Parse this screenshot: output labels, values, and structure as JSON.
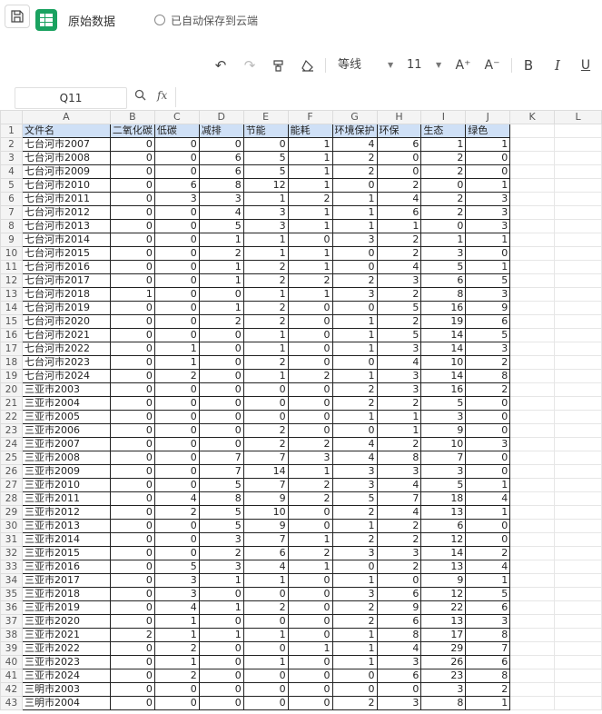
{
  "header": {
    "title": "原始数据",
    "autosave": "已自动保存到云端"
  },
  "toolbar": {
    "font_name": "等线",
    "font_size": "11",
    "increase_font": "A⁺",
    "decrease_font": "A⁻",
    "bold": "B",
    "italic": "I",
    "underline": "U"
  },
  "formula_bar": {
    "cell_ref": "Q11",
    "fx": "fx",
    "content": ""
  },
  "columns": [
    "A",
    "B",
    "C",
    "D",
    "E",
    "F",
    "G",
    "H",
    "I",
    "J",
    "K",
    "L"
  ],
  "header_row": [
    "文件名",
    "二氧化碳",
    "低碳",
    "减排",
    "节能",
    "能耗",
    "环境保护",
    "环保",
    "生态",
    "绿色"
  ],
  "rows": [
    [
      "七台河市2007",
      0,
      0,
      0,
      0,
      1,
      4,
      6,
      1,
      1
    ],
    [
      "七台河市2008",
      0,
      0,
      6,
      5,
      1,
      2,
      0,
      2,
      0
    ],
    [
      "七台河市2009",
      0,
      0,
      6,
      5,
      1,
      2,
      0,
      2,
      0
    ],
    [
      "七台河市2010",
      0,
      6,
      8,
      12,
      1,
      0,
      2,
      0,
      1
    ],
    [
      "七台河市2011",
      0,
      3,
      3,
      1,
      2,
      1,
      4,
      2,
      3
    ],
    [
      "七台河市2012",
      0,
      0,
      4,
      3,
      1,
      1,
      6,
      2,
      3
    ],
    [
      "七台河市2013",
      0,
      0,
      5,
      3,
      1,
      1,
      1,
      0,
      3
    ],
    [
      "七台河市2014",
      0,
      0,
      1,
      1,
      0,
      3,
      2,
      1,
      1
    ],
    [
      "七台河市2015",
      0,
      0,
      2,
      1,
      1,
      0,
      2,
      3,
      0
    ],
    [
      "七台河市2016",
      0,
      0,
      1,
      2,
      1,
      0,
      4,
      5,
      1
    ],
    [
      "七台河市2017",
      0,
      0,
      1,
      2,
      2,
      2,
      3,
      6,
      5
    ],
    [
      "七台河市2018",
      1,
      0,
      0,
      1,
      1,
      3,
      2,
      8,
      3
    ],
    [
      "七台河市2019",
      0,
      0,
      1,
      2,
      0,
      0,
      5,
      16,
      9
    ],
    [
      "七台河市2020",
      0,
      0,
      2,
      2,
      0,
      1,
      2,
      19,
      6
    ],
    [
      "七台河市2021",
      0,
      0,
      0,
      1,
      0,
      1,
      5,
      14,
      5
    ],
    [
      "七台河市2022",
      0,
      1,
      0,
      1,
      0,
      1,
      3,
      14,
      3
    ],
    [
      "七台河市2023",
      0,
      1,
      0,
      2,
      0,
      0,
      4,
      10,
      2
    ],
    [
      "七台河市2024",
      0,
      2,
      0,
      1,
      2,
      1,
      3,
      14,
      8
    ],
    [
      "三亚市2003",
      0,
      0,
      0,
      0,
      0,
      2,
      3,
      16,
      2
    ],
    [
      "三亚市2004",
      0,
      0,
      0,
      0,
      0,
      2,
      2,
      5,
      0
    ],
    [
      "三亚市2005",
      0,
      0,
      0,
      0,
      0,
      1,
      1,
      3,
      0
    ],
    [
      "三亚市2006",
      0,
      0,
      0,
      2,
      0,
      0,
      1,
      9,
      0
    ],
    [
      "三亚市2007",
      0,
      0,
      0,
      2,
      2,
      4,
      2,
      10,
      3
    ],
    [
      "三亚市2008",
      0,
      0,
      7,
      7,
      3,
      4,
      8,
      7,
      0
    ],
    [
      "三亚市2009",
      0,
      0,
      7,
      14,
      1,
      3,
      3,
      3,
      0
    ],
    [
      "三亚市2010",
      0,
      0,
      5,
      7,
      2,
      3,
      4,
      5,
      1
    ],
    [
      "三亚市2011",
      0,
      4,
      8,
      9,
      2,
      5,
      7,
      18,
      4
    ],
    [
      "三亚市2012",
      0,
      2,
      5,
      10,
      0,
      2,
      4,
      13,
      1
    ],
    [
      "三亚市2013",
      0,
      0,
      5,
      9,
      0,
      1,
      2,
      6,
      0
    ],
    [
      "三亚市2014",
      0,
      0,
      3,
      7,
      1,
      2,
      2,
      12,
      0
    ],
    [
      "三亚市2015",
      0,
      0,
      2,
      6,
      2,
      3,
      3,
      14,
      2
    ],
    [
      "三亚市2016",
      0,
      5,
      3,
      4,
      1,
      0,
      2,
      13,
      4
    ],
    [
      "三亚市2017",
      0,
      3,
      1,
      1,
      0,
      1,
      0,
      9,
      1
    ],
    [
      "三亚市2018",
      0,
      3,
      0,
      0,
      0,
      3,
      6,
      12,
      5
    ],
    [
      "三亚市2019",
      0,
      4,
      1,
      2,
      0,
      2,
      9,
      22,
      6
    ],
    [
      "三亚市2020",
      0,
      1,
      0,
      0,
      0,
      2,
      6,
      13,
      3
    ],
    [
      "三亚市2021",
      2,
      1,
      1,
      1,
      0,
      1,
      8,
      17,
      8
    ],
    [
      "三亚市2022",
      0,
      2,
      0,
      0,
      1,
      1,
      4,
      29,
      7
    ],
    [
      "三亚市2023",
      0,
      1,
      0,
      1,
      0,
      1,
      3,
      26,
      6
    ],
    [
      "三亚市2024",
      0,
      2,
      0,
      0,
      0,
      0,
      6,
      23,
      8
    ],
    [
      "三明市2003",
      0,
      0,
      0,
      0,
      0,
      0,
      0,
      3,
      2
    ],
    [
      "三明市2004",
      0,
      0,
      0,
      0,
      0,
      2,
      3,
      8,
      1
    ]
  ]
}
